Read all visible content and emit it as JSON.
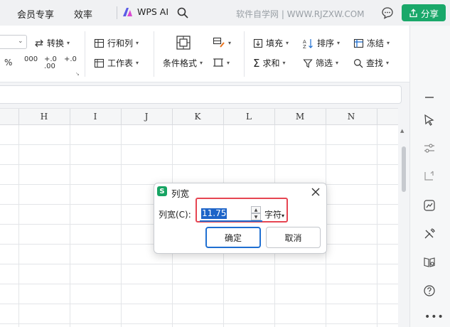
{
  "topbar": {
    "tabs": [
      {
        "label": "会员专享"
      },
      {
        "label": "效率"
      }
    ],
    "wps_ai_label": "WPS AI",
    "site_text": "软件自学网 | WWW.RJZXW.COM",
    "share_label": "分享"
  },
  "ribbon": {
    "convert_label": "转换",
    "rows_cols_label": "行和列",
    "worksheet_label": "工作表",
    "cond_format_label": "条件格式",
    "fill_label": "填充",
    "sort_label": "排序",
    "freeze_label": "冻结",
    "sum_label": "求和",
    "filter_label": "筛选",
    "find_label": "查找",
    "num_glyphs": [
      "%",
      "000",
      "+.0",
      ".00",
      "+.0"
    ]
  },
  "sheet": {
    "columns": [
      "H",
      "I",
      "J",
      "K",
      "L",
      "M",
      "N"
    ]
  },
  "dialog": {
    "title": "列宽",
    "logo_letter": "S",
    "label": "列宽(C):",
    "value": "11.75",
    "unit": "字符",
    "ok_label": "确定",
    "cancel_label": "取消"
  },
  "colors": {
    "accent_green": "#1aa86a",
    "highlight_red": "#e64552",
    "selection_blue": "#1d64c8"
  }
}
